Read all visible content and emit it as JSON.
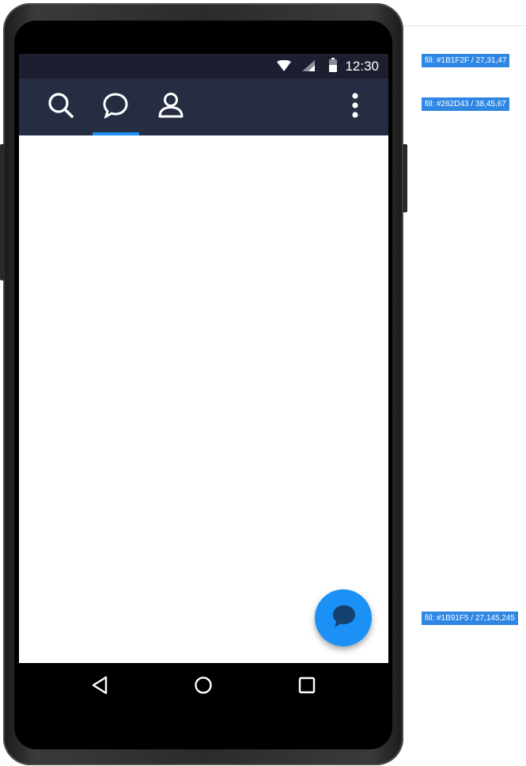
{
  "status_bar": {
    "time": "12:30",
    "icons": [
      "wifi-icon",
      "signal-icon",
      "battery-icon"
    ],
    "fill": "#1B1F2F"
  },
  "app_bar": {
    "fill": "#262D43",
    "tabs": [
      {
        "name": "search",
        "icon": "search-icon",
        "selected": false
      },
      {
        "name": "chat",
        "icon": "chat-bubble-icon",
        "selected": true
      },
      {
        "name": "profile",
        "icon": "person-icon",
        "selected": false
      }
    ],
    "menu_icon": "more-vert-icon",
    "indicator_color": "#1B91F5"
  },
  "fab": {
    "icon": "chat-bubble-icon",
    "fill": "#1B91F5"
  },
  "nav_bar": {
    "buttons": [
      "back-icon",
      "home-icon",
      "recents-icon"
    ]
  },
  "annotations": [
    {
      "label": "fill: #1B1F2F / 27,31,47"
    },
    {
      "label": "fill: #262D43 / 38,45,67"
    },
    {
      "label": "fill: #1B91F5 / 27,145,245"
    }
  ]
}
